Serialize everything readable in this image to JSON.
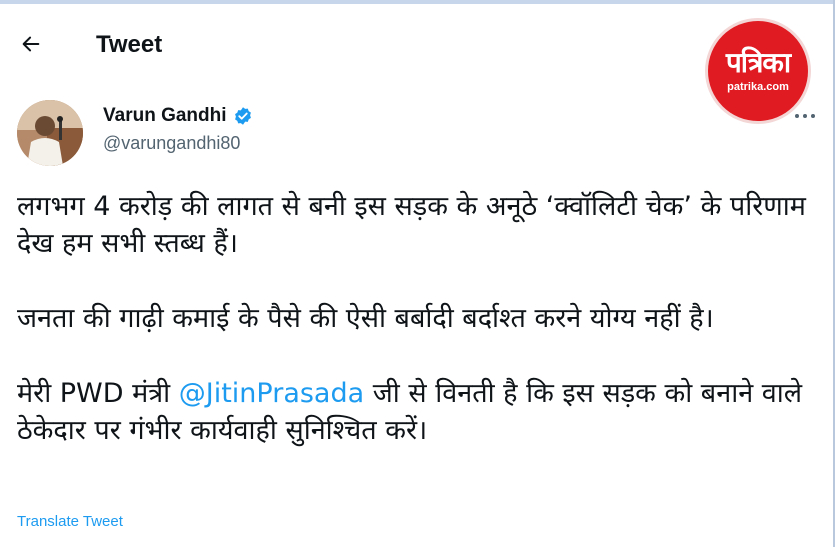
{
  "header": {
    "title": "Tweet",
    "logo_main": "पत्रिका",
    "logo_sub": "patrika.com"
  },
  "author": {
    "name": "Varun Gandhi",
    "handle": "@varungandhi80",
    "verified_icon": "verified-badge-icon"
  },
  "tweet": {
    "p1": "लगभग 4 करोड़ की लागत से बनी इस सड़क के अनूठे ‘क्वॉलिटी चेक’ के परिणाम देख हम सभी स्तब्ध हैं।",
    "p2": "जनता की गाढ़ी कमाई के पैसे की ऐसी बर्बादी बर्दाश्त करने योग्य नहीं है।",
    "p3_before": "मेरी PWD मंत्री ",
    "p3_mention": "@JitinPrasada",
    "p3_after": " जी से विनती है कि इस सड़क को बनाने वाले ठेकेदार पर गंभीर कार्यवाही सुनिश्चित करें।",
    "translate_label": "Translate Tweet"
  },
  "colors": {
    "accent": "#1d9bf0",
    "text": "#0f1419",
    "secondary": "#536471",
    "logo_red": "#e11b22"
  }
}
